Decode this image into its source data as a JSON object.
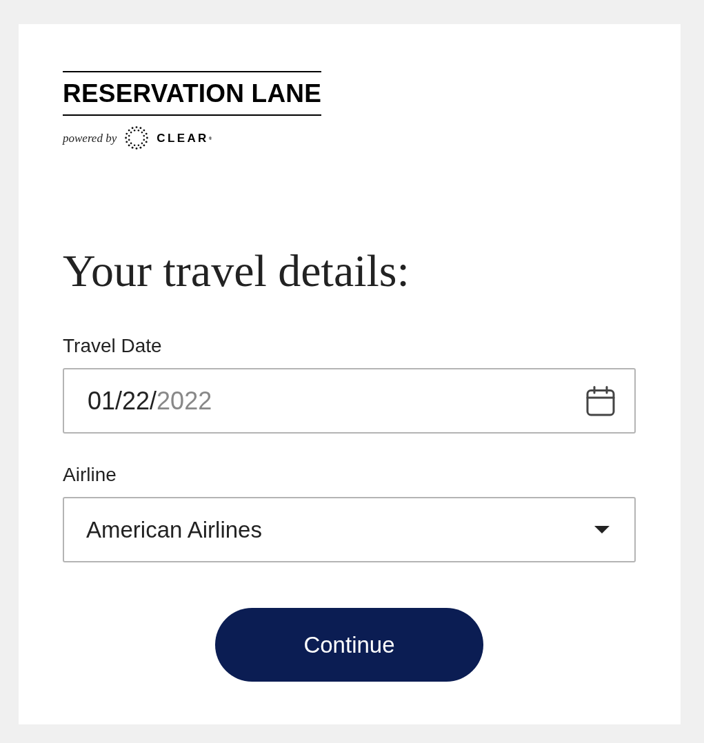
{
  "logo": {
    "wordmark": "RESERVATION LANE",
    "powered_by": "powered by",
    "partner": "CLEAR$^{®}$"
  },
  "heading": "Your travel details:",
  "fields": [
    {
      "kind": "date",
      "label": "Travel Date",
      "value": "01/22/",
      "mask": "2022"
    },
    {
      "kind": "select",
      "label": "Airline",
      "value": "American Airlines"
    }
  ],
  "button": {
    "label": "Continue"
  }
}
